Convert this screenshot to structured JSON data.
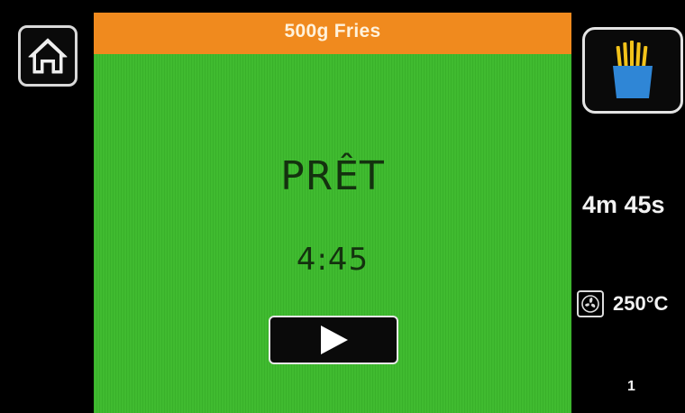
{
  "header": {
    "program_name": "500g Fries"
  },
  "status": {
    "state_label": "PRÊT",
    "timer": "4:45"
  },
  "sidebar_right": {
    "cook_time": "4m 45s",
    "temperature": "250°C",
    "level": "1"
  },
  "icons": {
    "home": "home-icon",
    "play": "play-icon",
    "fries": "fries-icon",
    "fan": "fan-icon"
  },
  "colors": {
    "header_bar": "#f08a1e",
    "status_panel": "#3cba2c",
    "fries_container": "#2f86d6",
    "fries": "#f2c21a"
  }
}
